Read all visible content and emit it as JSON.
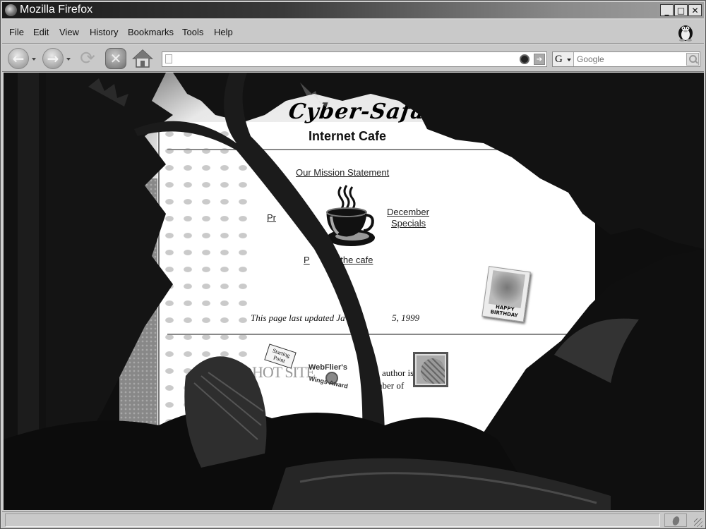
{
  "window": {
    "title": "Mozilla Firefox",
    "controls": {
      "minimize": "_",
      "maximize": "□",
      "close": "✕"
    }
  },
  "menu": {
    "items": [
      {
        "label": "File",
        "accesskey": "F"
      },
      {
        "label": "Edit",
        "accesskey": "E"
      },
      {
        "label": "View",
        "accesskey": "V"
      },
      {
        "label": "History",
        "accesskey": "s"
      },
      {
        "label": "Bookmarks",
        "accesskey": "B"
      },
      {
        "label": "Tools",
        "accesskey": "T"
      },
      {
        "label": "Help",
        "accesskey": "H"
      }
    ]
  },
  "navbar": {
    "back_icon": "back-arrow-icon",
    "forward_icon": "forward-arrow-icon",
    "reload_icon": "reload-icon",
    "stop_icon": "stop-icon",
    "home_icon": "home-icon",
    "url_value": "",
    "search_engine": "G",
    "search_placeholder": "Google"
  },
  "page": {
    "logo": "Cyber-Safari",
    "subtitle": "Internet Cafe",
    "links": {
      "mission": "Our Mission Statement",
      "pr_partial": "Pr",
      "december": "December",
      "specials": "Specials",
      "pictures_start": "P",
      "pictures_end": "f the cafe"
    },
    "updated_start": "This page last updated Ja",
    "updated_end": "5, 1999",
    "bday_label": "HAPPY BIRTHDAY",
    "starting_point": "Starting Point",
    "hot_site": "HOT SITE",
    "webflier_top": "WebFlier's",
    "webflier_bottom": "Wings Award",
    "author_line1": "author is",
    "author_line2": "nber of"
  },
  "status": {
    "text": ""
  }
}
